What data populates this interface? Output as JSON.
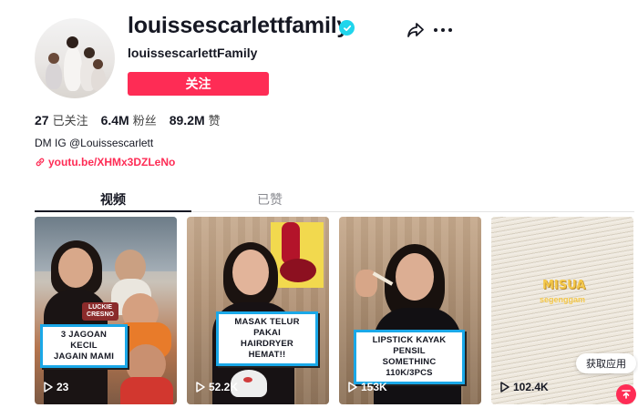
{
  "profile": {
    "username": "louissescarlettfamily",
    "nickname": "louissescarlettFamily",
    "follow_label": "关注",
    "verified": true
  },
  "stats": [
    {
      "value": "27",
      "label": "已关注"
    },
    {
      "value": "6.4M",
      "label": "粉丝"
    },
    {
      "value": "89.2M",
      "label": "赞"
    }
  ],
  "bio": "DM IG @Louissescarlett",
  "link": "youtu.be/XHMx3DZLeNo",
  "tabs": [
    {
      "label": "视频",
      "active": true
    },
    {
      "label": "已赞",
      "active": false
    }
  ],
  "videos": [
    {
      "caption": "3 JAGOAN KECIL\nJAGAIN MAMI",
      "overlay": "LUCKIE\nCRESNO",
      "views": "23"
    },
    {
      "caption": "MASAK TELUR PAKAI\nHAIRDRYER HEMAT!!",
      "views": "52.2K"
    },
    {
      "caption": "LIPSTICK KAYAK PENSIL\nSOMETHINC 110K/3PCS",
      "views": "153K"
    },
    {
      "caption": "MISUA",
      "subcaption": "segenggam",
      "views": "102.4K"
    }
  ],
  "get_app_label": "获取应用",
  "colors": {
    "accent": "#fe2c55",
    "verified": "#20d5ec",
    "caption_border": "#1aa8e8"
  },
  "icons": [
    "verified-badge-icon",
    "share-icon",
    "more-icon",
    "link-icon",
    "play-icon",
    "back-to-top-icon"
  ]
}
